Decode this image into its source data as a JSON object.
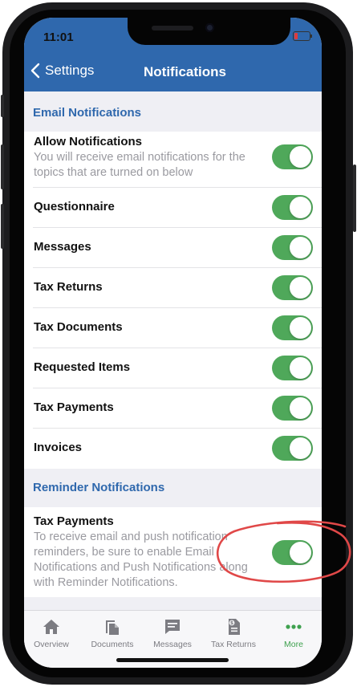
{
  "status": {
    "time": "11:01"
  },
  "nav": {
    "back_label": "Settings",
    "title": "Notifications"
  },
  "sections": {
    "email": {
      "header": "Email Notifications",
      "allow": {
        "title": "Allow Notifications",
        "desc_line1": "You will receive email notifications for the",
        "desc_line2": "topics that are turned on below",
        "enabled": true
      },
      "items": [
        {
          "label": "Questionnaire",
          "enabled": true
        },
        {
          "label": "Messages",
          "enabled": true
        },
        {
          "label": "Tax Returns",
          "enabled": true
        },
        {
          "label": "Tax Documents",
          "enabled": true
        },
        {
          "label": "Requested Items",
          "enabled": true
        },
        {
          "label": "Tax Payments",
          "enabled": true
        },
        {
          "label": "Invoices",
          "enabled": true
        }
      ]
    },
    "reminder": {
      "header": "Reminder Notifications",
      "tax_payments": {
        "title": "Tax Payments",
        "desc_line1": "To receive email and push notification",
        "desc_line2": "reminders, be sure to enable Email",
        "desc_line3": "Notifications and Push Notifications along",
        "desc_line4": "with Reminder Notifications.",
        "enabled": true
      }
    }
  },
  "tabs": [
    {
      "label": "Overview",
      "icon": "home-icon",
      "active": false
    },
    {
      "label": "Documents",
      "icon": "documents-icon",
      "active": false
    },
    {
      "label": "Messages",
      "icon": "message-icon",
      "active": false
    },
    {
      "label": "Tax Returns",
      "icon": "tax-return-icon",
      "active": false
    },
    {
      "label": "More",
      "icon": "more-dots-icon",
      "active": true
    }
  ],
  "colors": {
    "brand": "#2f68ad",
    "toggle_on": "#4fa85a",
    "active_tab": "#3fa14f",
    "annotation": "#e04848"
  }
}
